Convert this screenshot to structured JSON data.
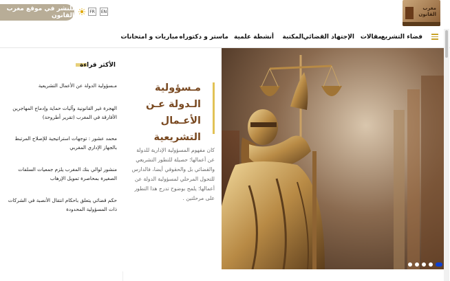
{
  "header": {
    "publish_label": "للنشر في موقع مغرب القانون",
    "lang_fr": "FR",
    "lang_en": "EN",
    "logo_text_line1": "مغرب",
    "logo_text_line2": "القانون"
  },
  "nav": {
    "items": [
      "فضاء التشريع",
      "مقالات",
      "الإجتهاد القضائي",
      "المكتبة",
      "أنشطة علمية",
      "ماستر و دكتوراه",
      "مباريات و امتحانات"
    ]
  },
  "sidebar": {
    "title": "الأكثر قراءة",
    "items": [
      "مـسؤولية الدولة عن الأعمال التشريعية",
      "الهجرة غير القانونية وآليات حماية وإدماج المهاجرين الأفارقة في المغرب (تقرير أطروحة)",
      "محمد عشور : توجهات استراتيجية للإصلاح المرتبط بالجهاز الإداري المغربي",
      "منشور لوالي بنك المغرب يلزم جمعيات السلفات الصغيرة بمحاصرة تمويل الإرهاب",
      "حكم قضائي يتعلق باحكام انتقال الأنصبة في الشركات ذات المسؤولية المحدودة"
    ]
  },
  "hero": {
    "title": "مـسؤولية الـدولة عـن الأعـمال التشريعية",
    "description": "كان مفهوم المسؤولية الإدارية للدولة عن أعمالها؛ حصيلة للتطور التشريعي والقضائي بل والحقوقي أيضا، فالدارس للتحول المرحلي لمسؤولية الدولة عن أعمالها؛ يلمح بوضوح تدرج هذا التطور على مرحلتين .",
    "image_alt": "lady-justice-statue",
    "slides_count": 6,
    "active_slide": 5
  },
  "colors": {
    "accent_gold": "#e2c255",
    "title_brown": "#7a4a22",
    "publish_bg": "#b8ad97",
    "dot_active": "#0b3fd1"
  }
}
